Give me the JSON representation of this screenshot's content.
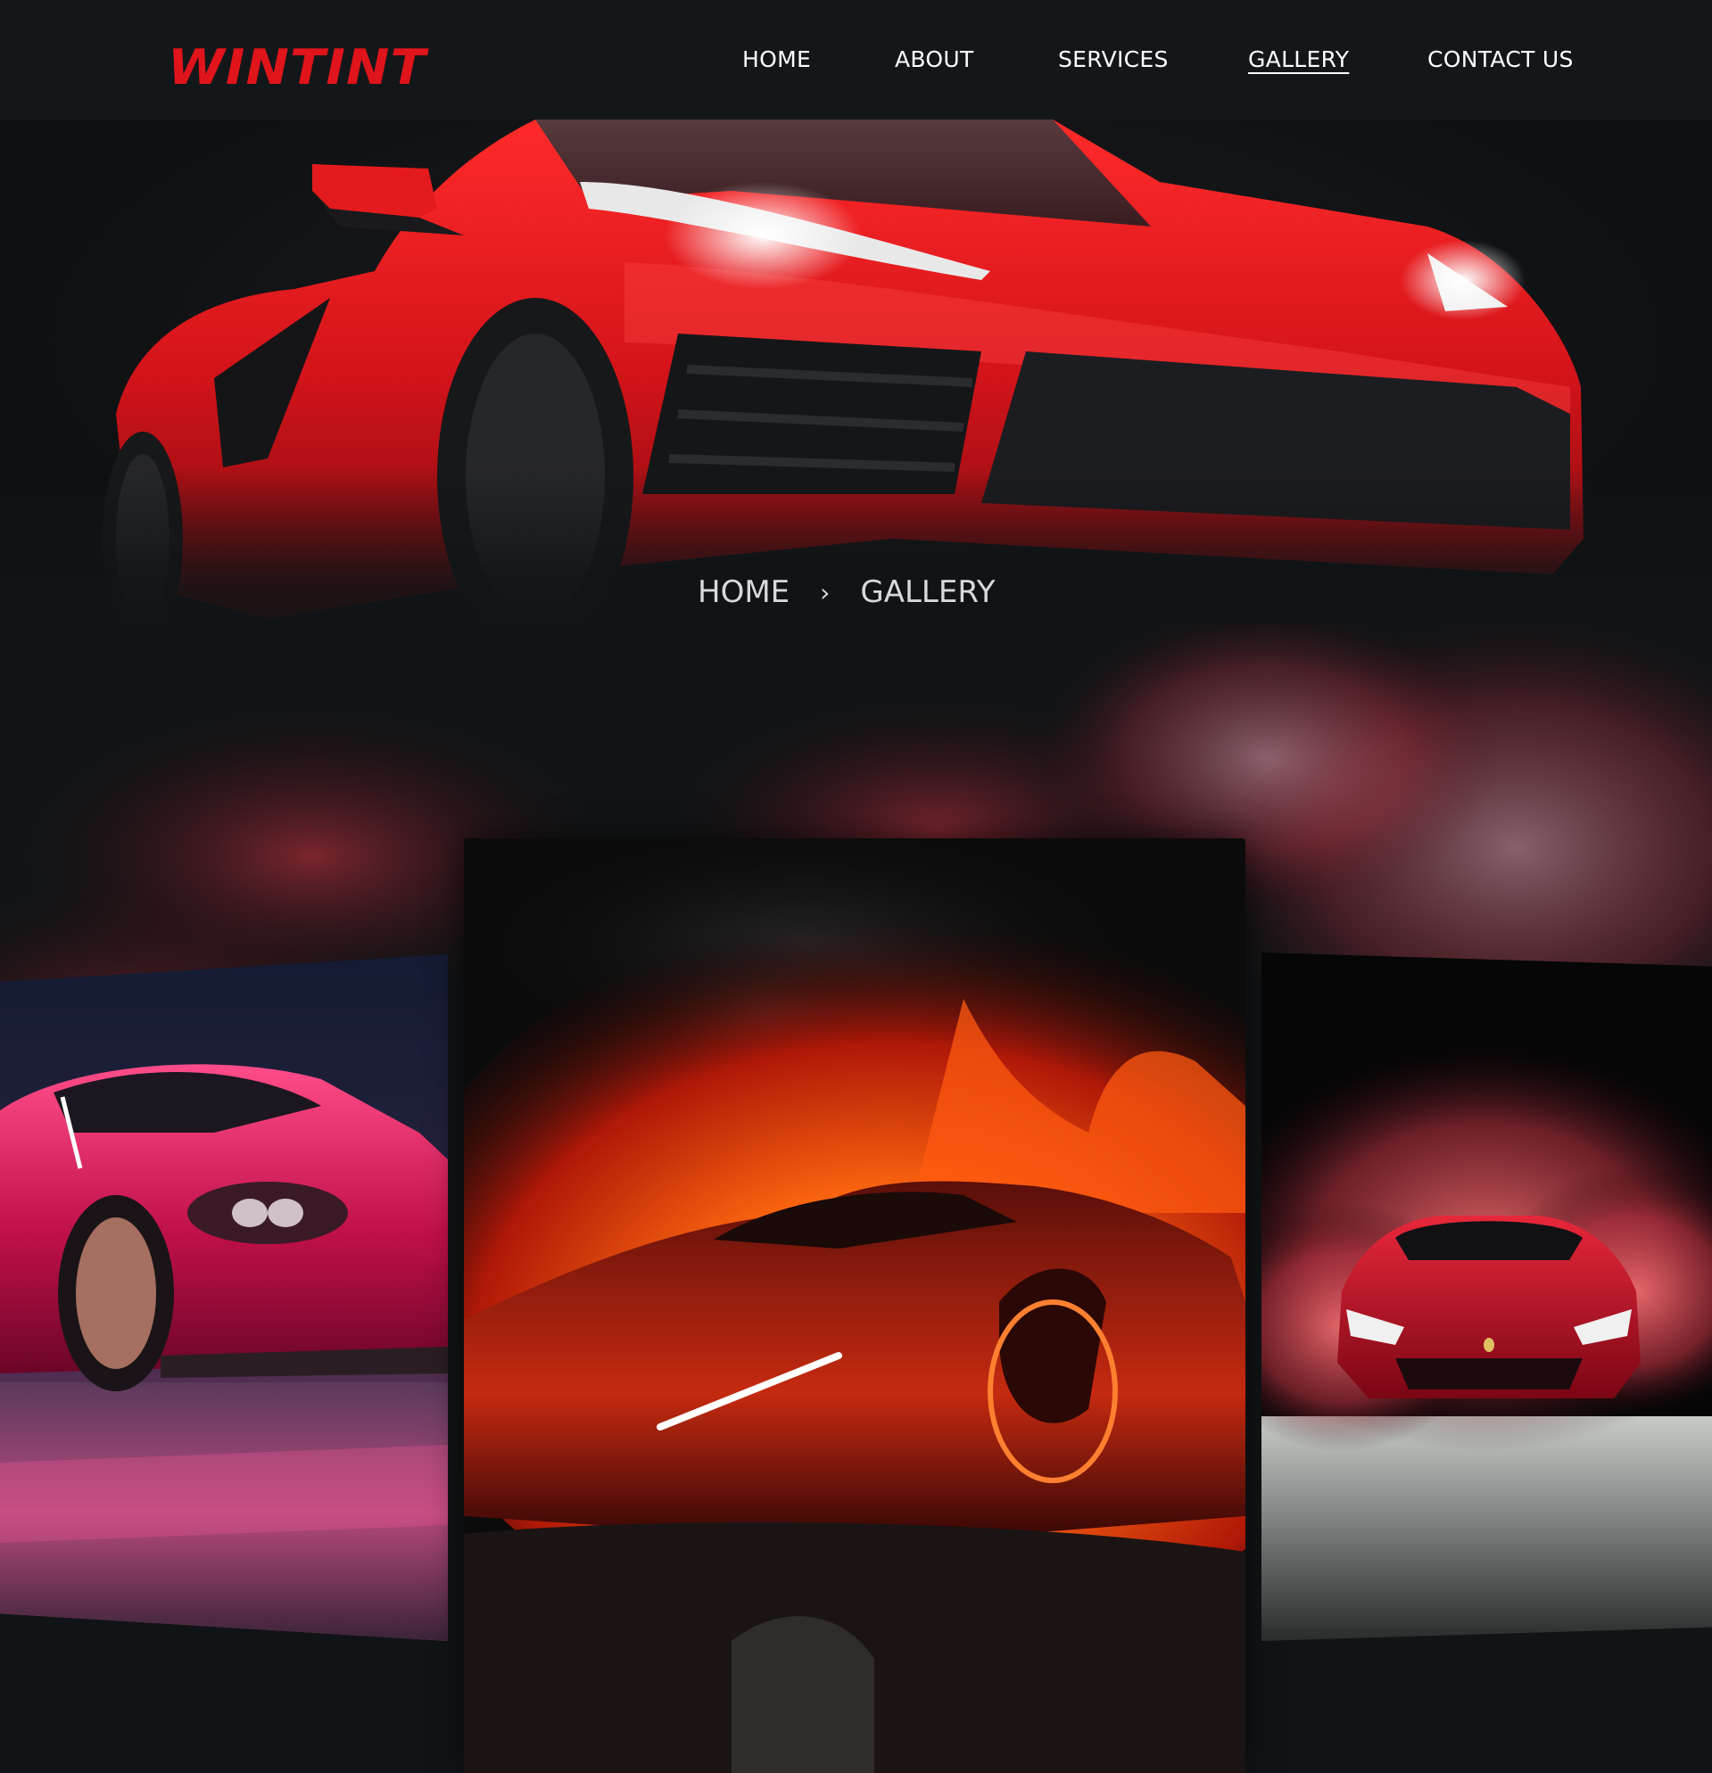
{
  "brand": {
    "logo_text": "WINTINT",
    "accent": "#e0141b"
  },
  "nav": {
    "items": [
      {
        "label": "HOME"
      },
      {
        "label": "ABOUT"
      },
      {
        "label": "SERVICES"
      },
      {
        "label": "GALLERY",
        "active": true
      },
      {
        "label": "CONTACT US"
      }
    ]
  },
  "breadcrumb": {
    "home": "HOME",
    "current": "GALLERY",
    "separator_icon": "chevron-right-icon"
  },
  "gallery": {
    "cards": [
      {
        "subject": "pink sports car in studio"
      },
      {
        "subject": "sports car in flames"
      },
      {
        "subject": "red sports car in smoke"
      }
    ]
  }
}
